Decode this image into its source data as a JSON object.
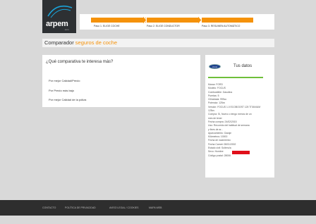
{
  "logo": {
    "brand": "arpem",
    "suffix": ".com"
  },
  "steps": [
    {
      "label": "Paso 1. ELIGE COCHE"
    },
    {
      "label": "Paso 2. ELIGE CONDUCTOR"
    },
    {
      "label": "Paso 3. RESUMEN AUTOMÁTICO"
    }
  ],
  "title": {
    "prefix": "Comparador",
    "accent": "seguros de coche"
  },
  "question": "¿Qué comparativa te interesa más?",
  "options": [
    "Por mejor Calidad/Precio",
    "Por Precio más bajo",
    "Por mejor Calidad de la póliza"
  ],
  "summary": {
    "brand_badge": "Ford",
    "heading": "Tus datos",
    "details": [
      "Marca: FORD",
      "Modelo: FOCUS",
      "Combustible: Gasolina",
      "Puertas: 5",
      "Cilindrada: 999cc",
      "Potencia: 125cv",
      "Versión: FOCUS 1.0 ECOBOOST 125 TITANIUM",
      "125cv",
      "Compra: Sí, Nuevo o tengo menos de un",
      "mes de tener",
      "Fecha compra: 24/02/2015",
      "Uso: Recorrido del habitual de semana",
      "y fines de ar...",
      "Aparcamiento: Garaje",
      "Kilómetros: 10000",
      "Fecha de nacimiento:",
      "Fecha Carnet: 08/01/2002",
      "Estado civil: Soltero/a",
      "Sexo: Hombre",
      "Código postal: 28006"
    ]
  },
  "footer": [
    "CONTACTO",
    "POLÍTICA DE PRIVACIDAD",
    "AVISO LEGAL / COOKIES",
    "MAPA WEB"
  ],
  "colors": {
    "accent": "#f5920a",
    "footer_bg": "#2e2e2e",
    "green": "#6fbf3a",
    "redact": "#e0101a"
  }
}
